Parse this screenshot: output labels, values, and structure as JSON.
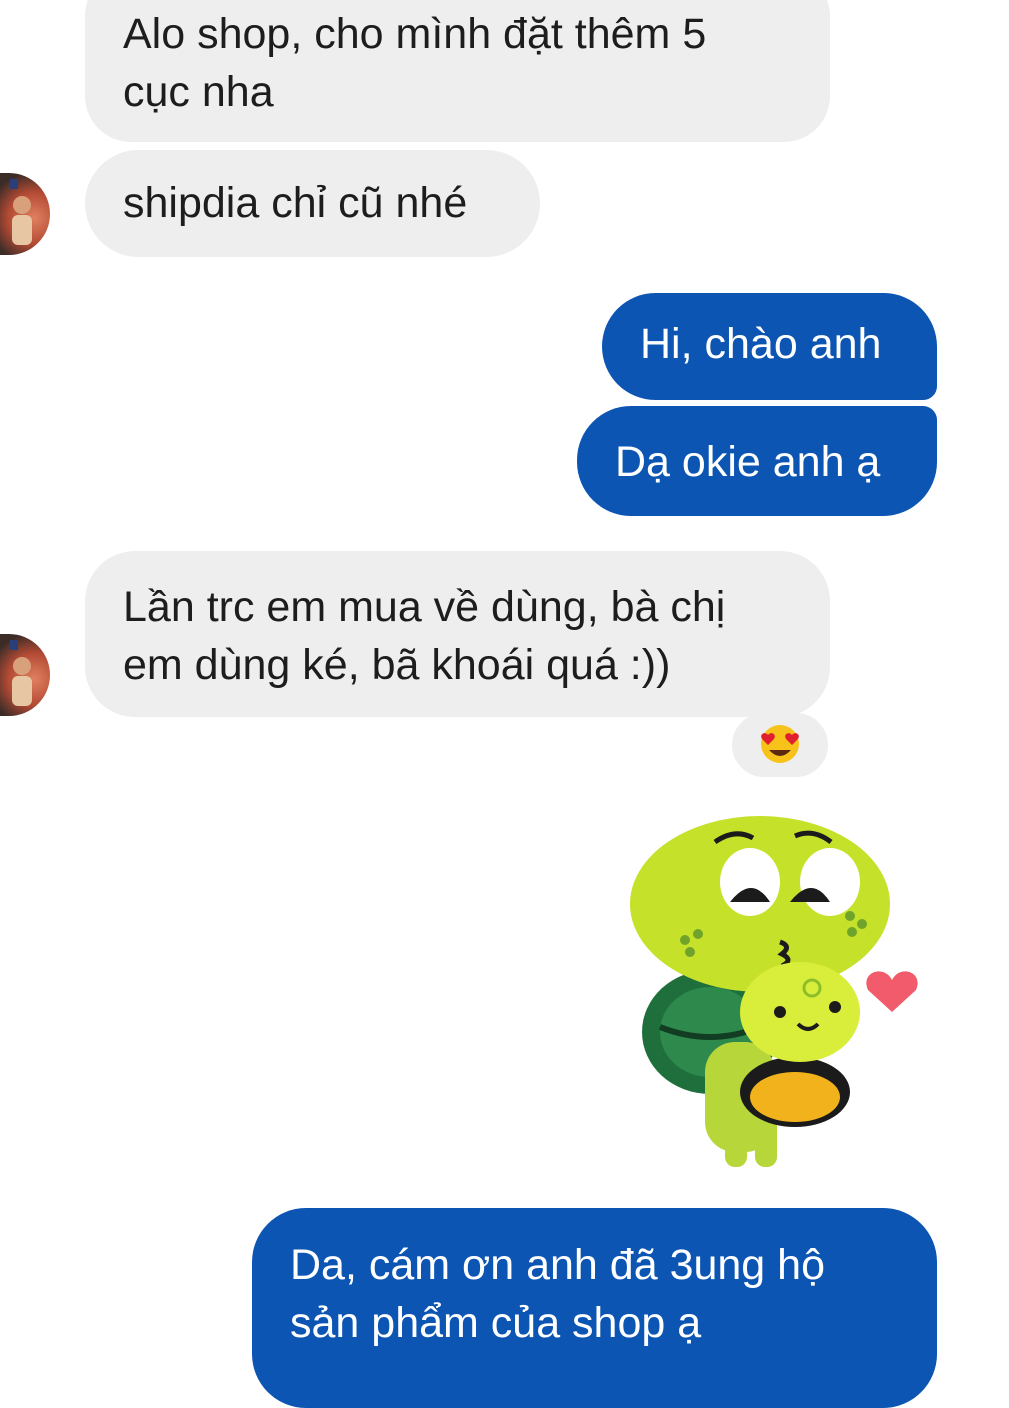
{
  "messages": [
    {
      "id": "msg1",
      "sender": "contact",
      "text": "Alo shop, cho mình đặt thêm 5\ncục nha"
    },
    {
      "id": "msg2",
      "sender": "contact",
      "text": "shipdia chỉ cũ nhé"
    },
    {
      "id": "msg3",
      "sender": "me",
      "text": "Hi, chào anh"
    },
    {
      "id": "msg4",
      "sender": "me",
      "text": "Dạ okie anh ạ"
    },
    {
      "id": "msg5",
      "sender": "contact",
      "text": "Lần trc em mua về dùng, bà chị\nem dùng ké, bã khoái quá :))"
    },
    {
      "id": "msg6",
      "sender": "me",
      "text": "Da, cám ơn anh đã 3ung hộ\nsản phẩm của shop ạ"
    }
  ],
  "reaction": {
    "emoji": "heart-eyes-face-icon",
    "on_message": "msg5"
  },
  "sticker": {
    "icon": "turtle-hug-heart-sticker-icon"
  },
  "colors": {
    "incoming_bubble": "#eeeeee",
    "outgoing_bubble": "#0c55b3",
    "incoming_text": "#1d1d1d",
    "outgoing_text": "#ffffff"
  }
}
